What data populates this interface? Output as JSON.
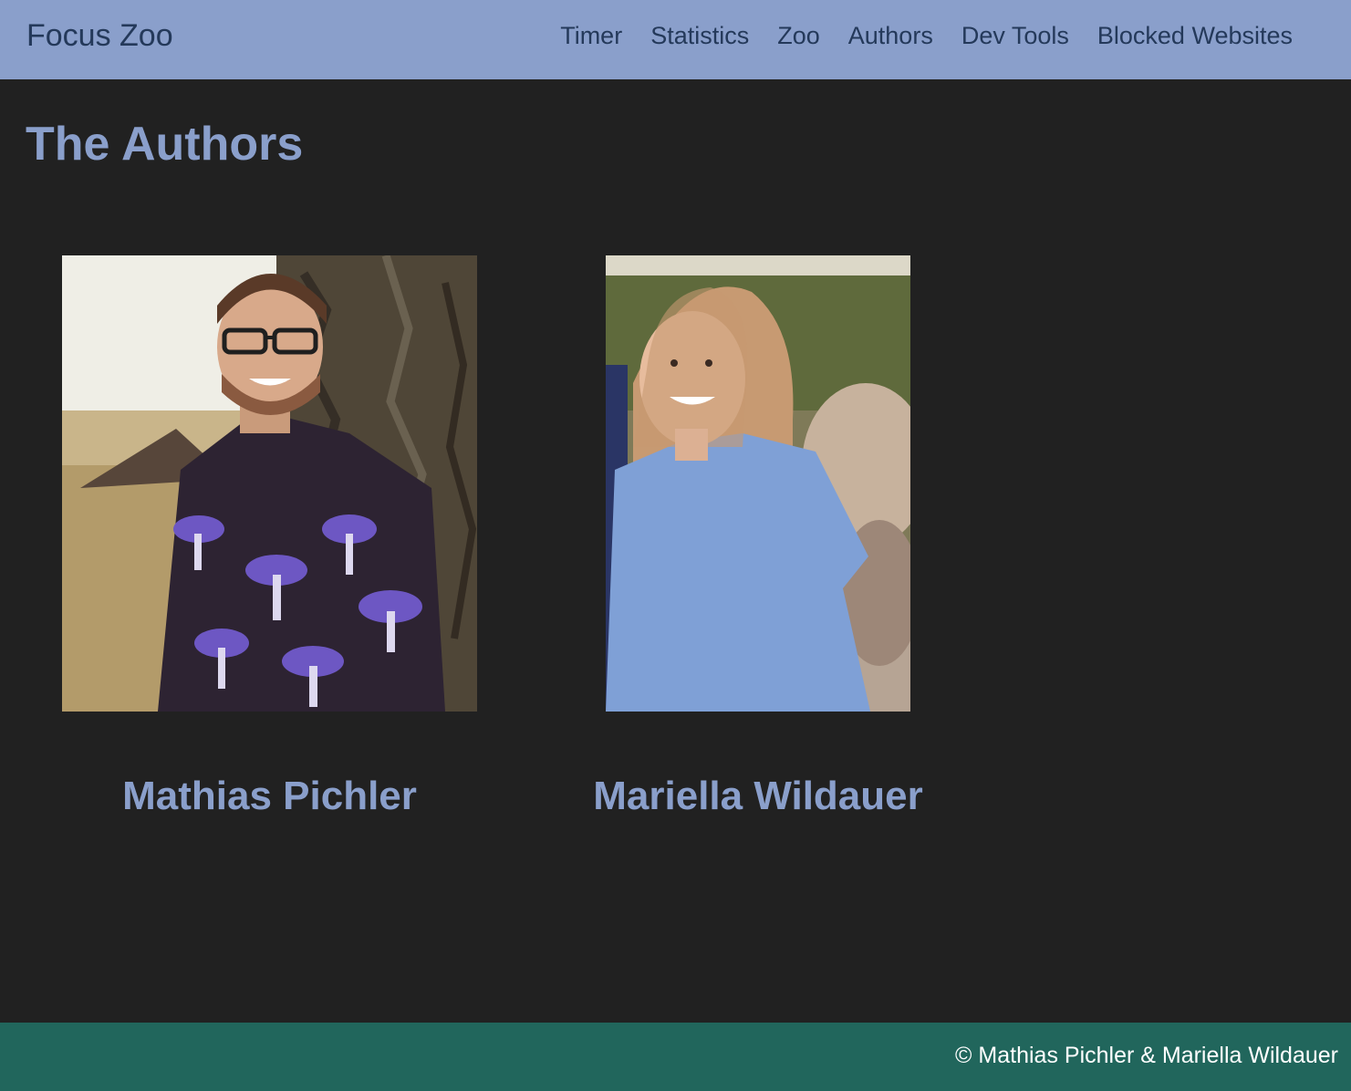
{
  "app": {
    "brand": "Focus Zoo"
  },
  "nav": {
    "items": [
      {
        "label": "Timer"
      },
      {
        "label": "Statistics"
      },
      {
        "label": "Zoo"
      },
      {
        "label": "Authors"
      },
      {
        "label": "Dev Tools"
      },
      {
        "label": "Blocked Websites"
      }
    ]
  },
  "main": {
    "title": "The Authors",
    "authors": [
      {
        "name": "Mathias Pichler",
        "photo": "photo-man-glasses-mushroom-shirt-tree"
      },
      {
        "name": "Mariella Wildauer",
        "photo": "photo-woman-blue-tshirt-rocks"
      }
    ]
  },
  "footer": {
    "copyright": "© Mathias Pichler & Mariella Wildauer"
  },
  "colors": {
    "navbar": "#8a9fcb",
    "nav_text": "#24395a",
    "background": "#212121",
    "accent": "#8a9fcb",
    "footer": "#21665c",
    "footer_text": "#ffffff"
  }
}
